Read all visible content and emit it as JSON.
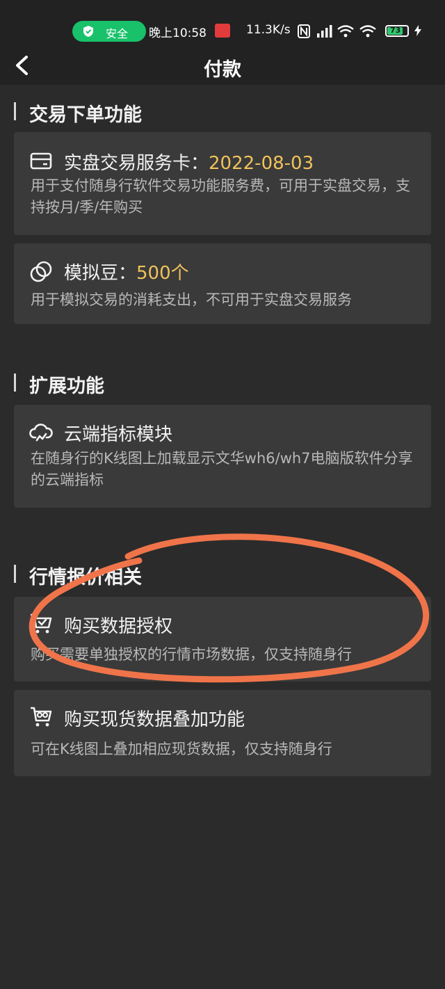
{
  "status_bar": {
    "safe_label": "安全",
    "time": "晚上10:58",
    "net_speed": "11.3K/s",
    "battery": "73",
    "icons": [
      "shield-icon",
      "app-notification-icon",
      "nfc-icon",
      "signal-icon",
      "wifi-icon",
      "wifi-icon",
      "battery-icon",
      "charging-icon"
    ]
  },
  "header": {
    "title": "付款",
    "back_icon": "chevron-left-icon"
  },
  "sections": [
    {
      "title": "交易下单功能",
      "items": [
        {
          "title": "实盘交易服务卡：",
          "value": "2022-08-03",
          "desc": "用于支付随身行软件交易功能服务费，可用于实盘交易，支持按月/季/年购买",
          "icon": "card-icon"
        },
        {
          "title": "模拟豆：",
          "value": "500个",
          "desc": "用于模拟交易的消耗支出，不可用于实盘交易服务",
          "icon": "bean-icon"
        }
      ]
    },
    {
      "title": "扩展功能",
      "items": [
        {
          "title": "云端指标模块",
          "desc": "在随身行的K线图上加载显示文华wh6/wh7电脑版软件分享的云端指标",
          "icon": "cloud-icon"
        }
      ]
    },
    {
      "title": "行情报价相关",
      "items": [
        {
          "title": "购买数据授权",
          "desc": "购买需要单独授权的行情市场数据，仅支持随身行",
          "icon": "cart-check-icon"
        },
        {
          "title": "购买现货数据叠加功能",
          "desc": "可在K线图上叠加相应现货数据，仅支持随身行",
          "icon": "cart-plus-icon"
        }
      ]
    }
  ],
  "colors": {
    "background": "#2b2b2b",
    "bar": "#222222",
    "card": "#3a3a3a",
    "accent_value": "#f0c25a",
    "safe_green": "#19c16a",
    "annotation": "#f0744a"
  }
}
